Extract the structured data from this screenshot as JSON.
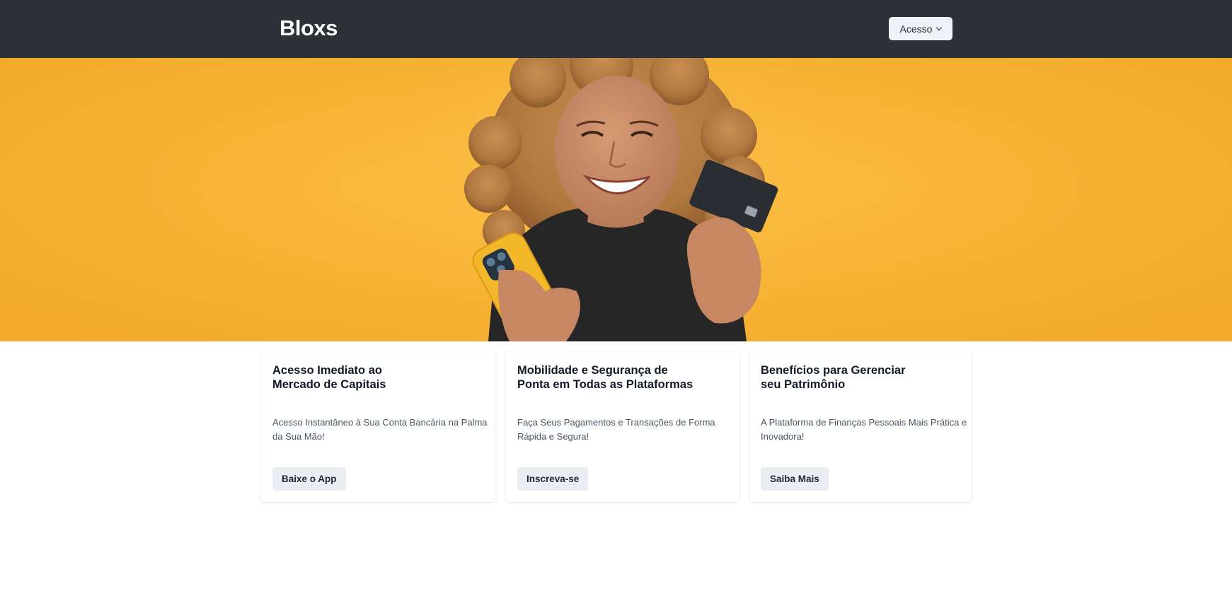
{
  "header": {
    "brand": "Bloxs",
    "access_label": "Acesso",
    "access_icon": "chevron-down-icon"
  },
  "hero": {
    "image_description_icon": "woman-holding-phone-and-card-photo",
    "background_color": "#f6b233"
  },
  "cards": [
    {
      "title_line1": "Acesso Imediato ao",
      "title_line2": "Mercado de Capitais",
      "text": "Acesso Instantâneo à Sua Conta Bancária na Palma da Sua Mão!",
      "button": "Baixe o App"
    },
    {
      "title_line1": "Mobilidade e Segurança de",
      "title_line2": "Ponta em Todas as Plataformas",
      "text": "Faça Seus Pagamentos e Transações de Forma Rápida e Segura!",
      "button": "Inscreva-se"
    },
    {
      "title_line1": "Benefícios para Gerenciar",
      "title_line2": "seu Patrimônio",
      "text": "A Plataforma de Finanças Pessoais Mais Prática e Inovadora!",
      "button": "Saiba Mais"
    }
  ],
  "colors": {
    "header_bg": "#2b3238",
    "hero_bg": "#f6b233",
    "button_bg": "#eaeef3"
  }
}
